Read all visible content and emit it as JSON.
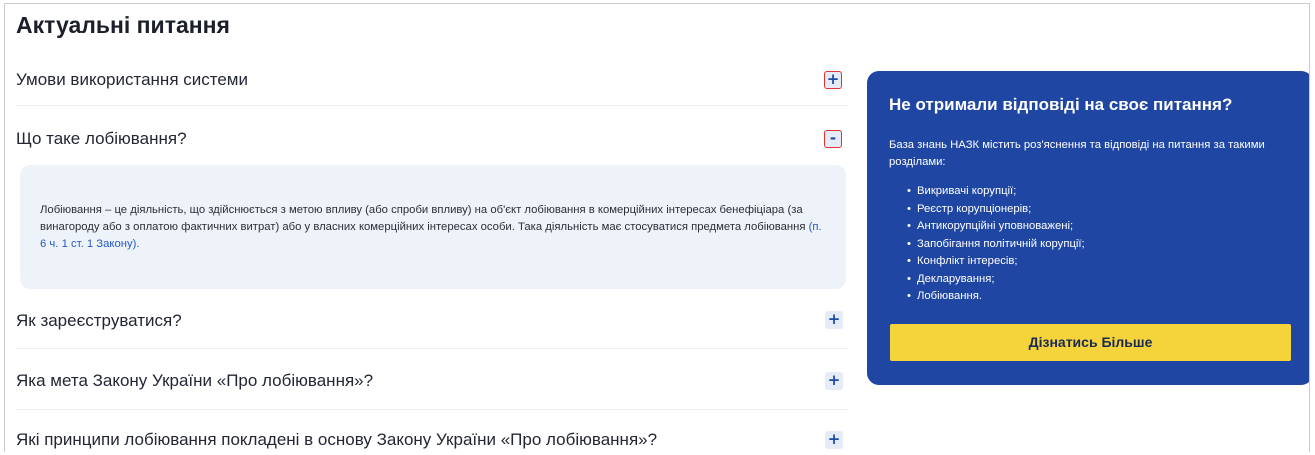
{
  "page_title": "Актуальні питання",
  "faq": [
    {
      "question": "Умови використання системи",
      "toggle": "+"
    },
    {
      "question": "Що таке лобіювання?",
      "toggle": "-",
      "answer_text": "Лобіювання – це діяльність, що здійснюється з метою впливу (або спроби впливу) на об'єкт лобіювання в комерційних інтересах бенефіціара (за винагороду або з оплатою фактичних витрат) або у власних комерційних інтересах особи. Така діяльність має стосуватися предмета лобіювання ",
      "answer_link": "(п. 6 ч. 1 ст. 1 Закону)."
    },
    {
      "question": "Як зареєструватися?",
      "toggle": "+"
    },
    {
      "question": "Яка мета Закону України «Про лобіювання»?",
      "toggle": "+"
    },
    {
      "question": "Які принципи лобіювання покладені в основу Закону України «Про лобіювання»?",
      "toggle": "+"
    }
  ],
  "info_card": {
    "heading": "Не отримали відповіді на своє питання?",
    "description": "База знань НАЗК містить роз'яснення та відповіді на питання за такими розділами:",
    "sections": [
      "Викривачі корупції;",
      "Реєстр корупціонерів;",
      "Антикорупційні уповноважені;",
      "Запобігання політичній корупції;",
      "Конфлікт інтересів;",
      "Декларування;",
      "Лобіювання."
    ],
    "button_label": "Дізнатись Більше"
  },
  "colors": {
    "accent_blue": "#1f46a3",
    "button_yellow": "#f5d33a",
    "answer_bg": "#eef3fa",
    "highlight_red": "#e0342f",
    "link_blue": "#2458c6"
  }
}
